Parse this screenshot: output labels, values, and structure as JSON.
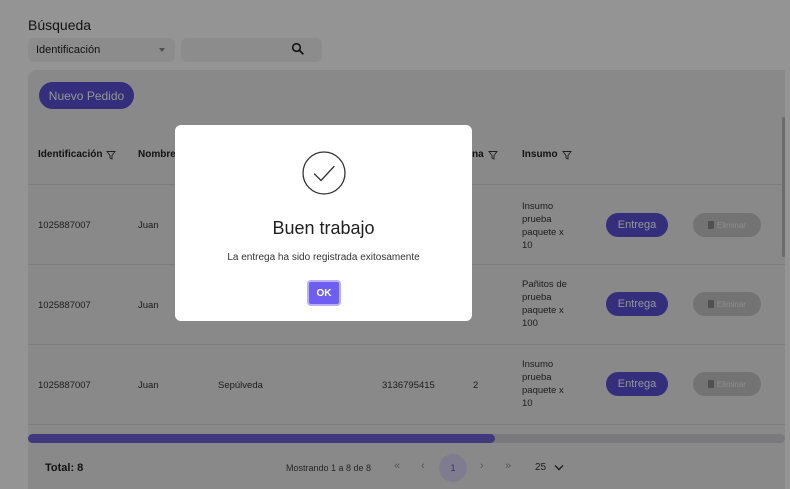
{
  "search": {
    "title": "Búsqueda",
    "filter_selected": "Identificación",
    "input_value": ""
  },
  "toolbar": {
    "new_order_label": "Nuevo Pedido"
  },
  "table": {
    "headers": {
      "identificacion": "Identificación",
      "nombres": "Nombres",
      "partial": "na",
      "insumo": "Insumo"
    },
    "rows": [
      {
        "id": "1025887007",
        "name": "Juan",
        "apellido": "",
        "telefono": "",
        "cantidad": "",
        "insumo": [
          "Insumo",
          "prueba",
          "paquete x",
          "10"
        ],
        "entrega": "Entrega",
        "eliminar": "Eliminar"
      },
      {
        "id": "1025887007",
        "name": "Juan",
        "apellido": "",
        "telefono": "",
        "cantidad": "",
        "insumo": [
          "Pañitos de",
          "prueba",
          "paquete x",
          "100"
        ],
        "entrega": "Entrega",
        "eliminar": "Eliminar"
      },
      {
        "id": "1025887007",
        "name": "Juan",
        "apellido": "Sepúlveda",
        "telefono": "3136795415",
        "cantidad": "2",
        "insumo": [
          "Insumo",
          "prueba",
          "paquete x",
          "10"
        ],
        "entrega": "Entrega",
        "eliminar": "Eliminar"
      }
    ]
  },
  "footer": {
    "total": "Total: 8",
    "showing": "Mostrando 1 a 8 de 8",
    "first": "«",
    "prev": "‹",
    "current_page": "1",
    "next": "›",
    "last": "»",
    "page_size": "25"
  },
  "modal": {
    "title": "Buen trabajo",
    "message": "La entrega ha sido registrada exitosamente",
    "ok_label": "OK"
  },
  "colors": {
    "accent": "#5b50d6",
    "ok_button": "#6f5ff0",
    "disabled": "#c7c7c7"
  }
}
